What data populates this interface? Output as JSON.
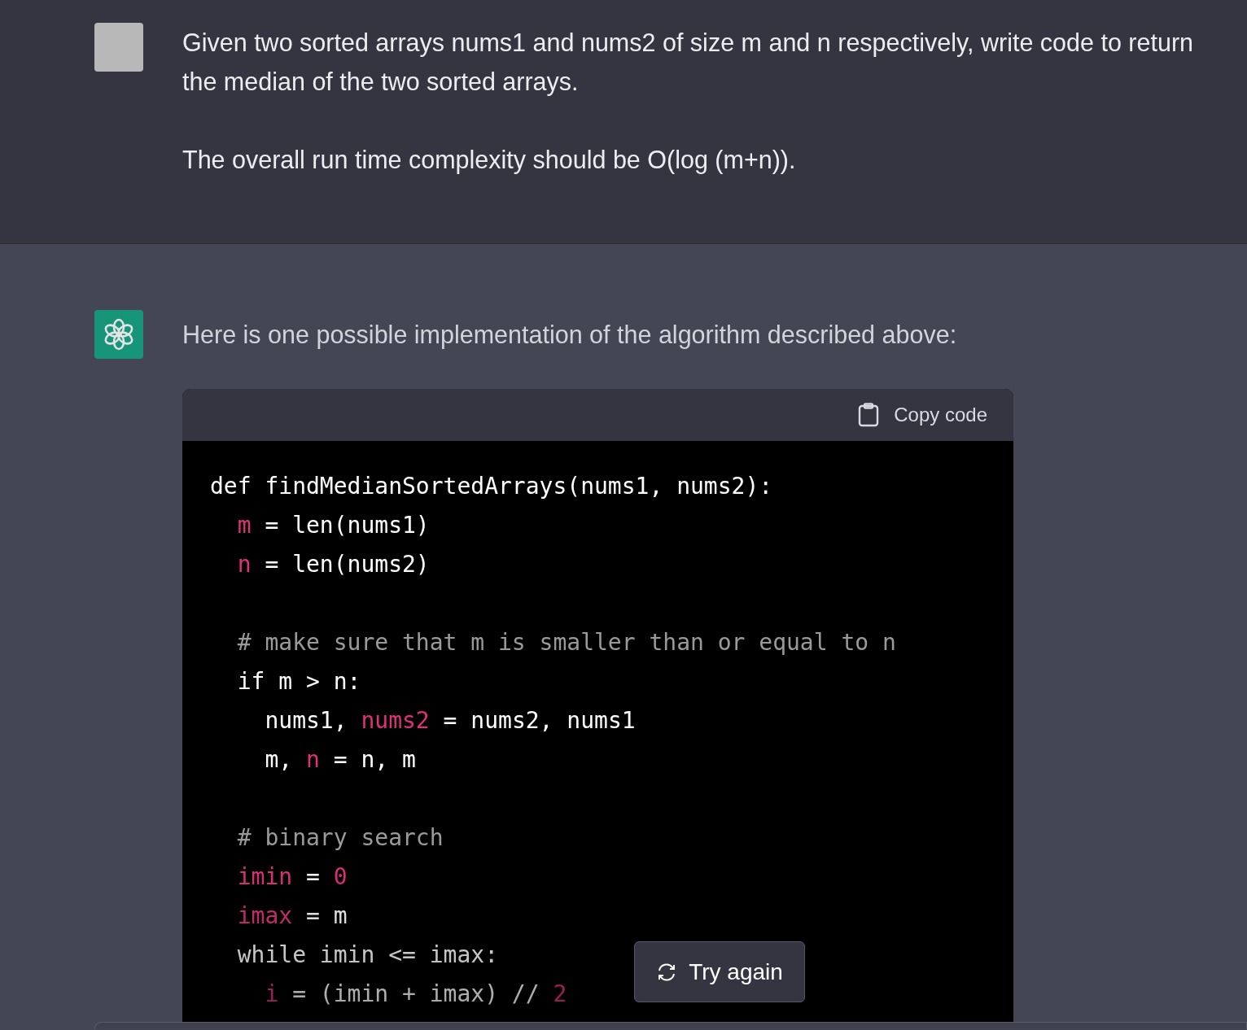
{
  "user_message": {
    "paragraphs": [
      "Given two sorted arrays nums1 and nums2 of size m and n respectively, write code to return the median of the two sorted arrays.",
      "The overall run time complexity should be O(log (m+n))."
    ]
  },
  "assistant_message": {
    "intro": "Here is one possible implementation of the algorithm described above:",
    "code_block": {
      "copy_label": "Copy code",
      "lines": [
        {
          "kind": "code",
          "segments": [
            {
              "kind": "plain",
              "text": "def findMedianSortedArrays(nums1, nums2):"
            }
          ]
        },
        {
          "kind": "code",
          "segments": [
            {
              "kind": "var",
              "text": "  m"
            },
            {
              "kind": "plain",
              "text": " = len(nums1)"
            }
          ]
        },
        {
          "kind": "code",
          "segments": [
            {
              "kind": "var",
              "text": "  n"
            },
            {
              "kind": "plain",
              "text": " = len(nums2)"
            }
          ]
        },
        {
          "kind": "blank"
        },
        {
          "kind": "code",
          "segments": [
            {
              "kind": "comment",
              "text": "  # make sure that m is smaller than or equal to n"
            }
          ]
        },
        {
          "kind": "code",
          "segments": [
            {
              "kind": "plain",
              "text": "  if m > n:"
            }
          ]
        },
        {
          "kind": "code",
          "segments": [
            {
              "kind": "plain",
              "text": "    nums1, "
            },
            {
              "kind": "var",
              "text": "nums2"
            },
            {
              "kind": "plain",
              "text": " = nums2, nums1"
            }
          ]
        },
        {
          "kind": "code",
          "segments": [
            {
              "kind": "plain",
              "text": "    m, "
            },
            {
              "kind": "var",
              "text": "n"
            },
            {
              "kind": "plain",
              "text": " = n, m"
            }
          ]
        },
        {
          "kind": "blank"
        },
        {
          "kind": "code",
          "segments": [
            {
              "kind": "comment",
              "text": "  # binary search"
            }
          ]
        },
        {
          "kind": "code",
          "segments": [
            {
              "kind": "var",
              "text": "  imin"
            },
            {
              "kind": "plain",
              "text": " = "
            },
            {
              "kind": "var",
              "text": "0"
            }
          ]
        },
        {
          "kind": "code",
          "segments": [
            {
              "kind": "var",
              "text": "  imax"
            },
            {
              "kind": "plain",
              "text": " = m"
            }
          ]
        },
        {
          "kind": "code",
          "segments": [
            {
              "kind": "plain",
              "text": "  while imin <= imax:"
            }
          ]
        },
        {
          "kind": "code",
          "segments": [
            {
              "kind": "var",
              "text": "    i"
            },
            {
              "kind": "plain",
              "text": " = (imin + imax) // "
            },
            {
              "kind": "var",
              "text": "2"
            }
          ]
        }
      ]
    },
    "try_again_label": "Try again"
  }
}
